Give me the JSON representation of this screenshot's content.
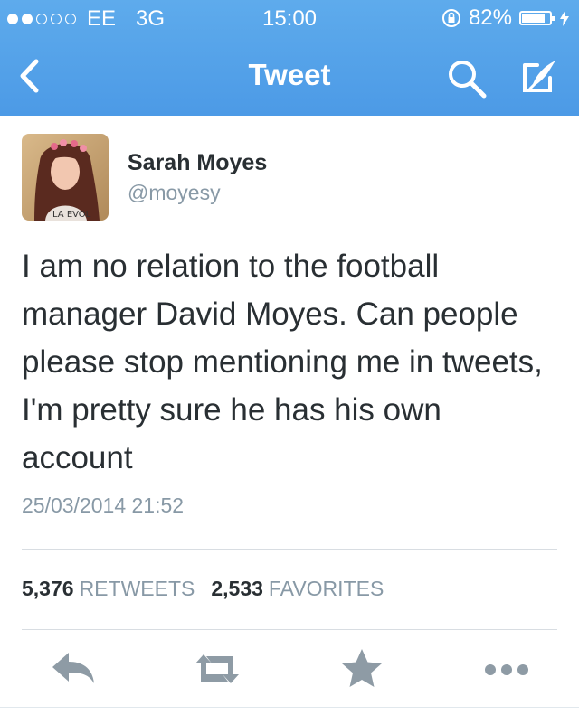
{
  "status_bar": {
    "signal_dots_filled": 2,
    "signal_dots_total": 5,
    "carrier": "EE",
    "network": "3G",
    "time": "15:00",
    "battery_percent": "82%",
    "battery_level": 0.82
  },
  "nav": {
    "title": "Tweet",
    "back_icon": "chevron-left-icon",
    "search_icon": "search-icon",
    "compose_icon": "compose-icon"
  },
  "tweet": {
    "author_name": "Sarah Moyes",
    "author_handle": "@moyesy",
    "text": "I am no relation to the football manager David Moyes. Can people please stop mentioning me in tweets, I'm pretty sure he has his own account",
    "timestamp": "25/03/2014 21:52",
    "retweets_count": "5,376",
    "retweets_label": "RETWEETS",
    "favorites_count": "2,533",
    "favorites_label": "FAVORITES"
  },
  "actions": [
    {
      "name": "reply",
      "icon": "reply-icon"
    },
    {
      "name": "retweet",
      "icon": "retweet-icon"
    },
    {
      "name": "favorite",
      "icon": "star-icon"
    },
    {
      "name": "more",
      "icon": "more-icon"
    }
  ],
  "colors": {
    "nav_blue": "#55a4ea",
    "text_dark": "#292f33",
    "text_gray": "#8899a6",
    "action_gray": "#8e9ba5"
  }
}
